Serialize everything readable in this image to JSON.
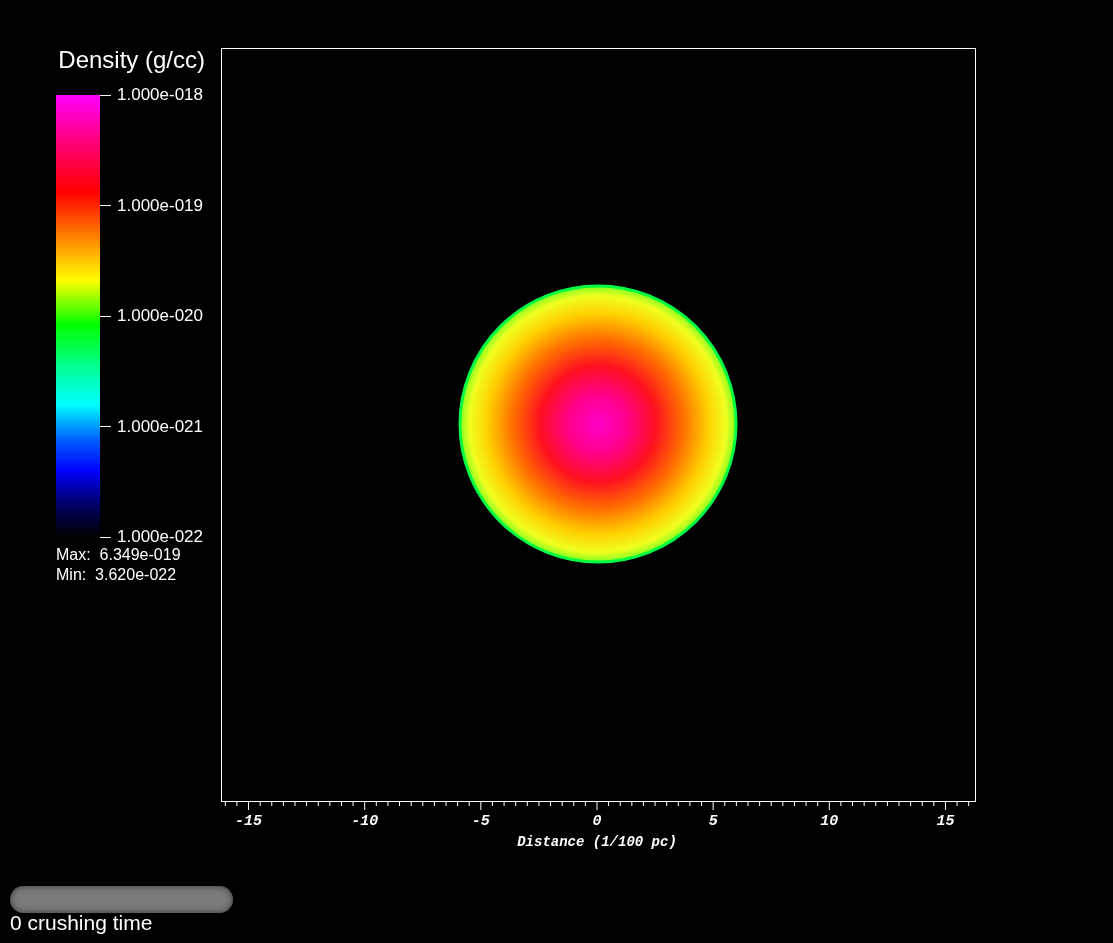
{
  "legend": {
    "title": "Density (g/cc)",
    "ticks": [
      "1.000e-018",
      "1.000e-019",
      "1.000e-020",
      "1.000e-021",
      "1.000e-022"
    ],
    "max": "Max:  6.349e-019",
    "min": "Min:  3.620e-022"
  },
  "plot": {
    "xticks": [
      "-15",
      "-10",
      "-5",
      "0",
      "5",
      "10",
      "15"
    ],
    "xlabel": "Distance (1/100 pc)"
  },
  "time_slider": {
    "label": "0 crushing time"
  }
}
